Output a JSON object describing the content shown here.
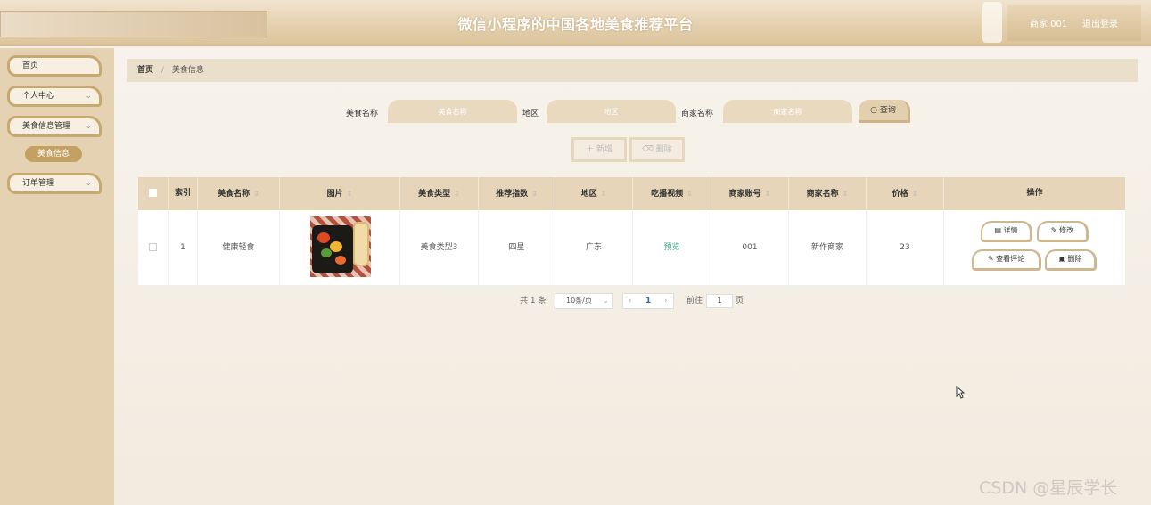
{
  "header": {
    "title": "微信小程序的中国各地美食推荐平台",
    "user": "商家 001",
    "logout": "退出登录"
  },
  "sidebar": {
    "items": [
      {
        "label": "首页"
      },
      {
        "label": "个人中心"
      },
      {
        "label": "美食信息管理"
      },
      {
        "label": "订单管理"
      }
    ],
    "sub_item": "美食信息"
  },
  "breadcrumb": {
    "home": "首页",
    "separator": "/",
    "current": "美食信息"
  },
  "search": {
    "name_label": "美食名称",
    "name_placeholder": "美食名称",
    "region_label": "地区",
    "region_placeholder": "地区",
    "merchant_label": "商家名称",
    "merchant_placeholder": "商家名称",
    "query_button": "查询"
  },
  "actions": {
    "add": "新增",
    "delete": "删除"
  },
  "table": {
    "headers": [
      "索引",
      "美食名称",
      "图片",
      "美食类型",
      "推荐指数",
      "地区",
      "吃播视频",
      "商家账号",
      "商家名称",
      "价格",
      "操作"
    ],
    "rows": [
      {
        "index": "1",
        "name": "健康轻食",
        "type": "美食类型3",
        "rating": "四星",
        "region": "广东",
        "video": "预览",
        "merchant_account": "001",
        "merchant_name": "新作商家",
        "price": "23",
        "ops": {
          "detail": "详情",
          "edit": "修改",
          "comments": "查看评论",
          "delete": "删除"
        }
      }
    ]
  },
  "pagination": {
    "total": "共 1 条",
    "page_size": "10条/页",
    "current_page": "1",
    "goto_label": "前往",
    "goto_value": "1",
    "page_suffix": "页"
  },
  "watermark": "CSDN @星辰学长",
  "colors": {
    "accent": "#c3a165",
    "header_bg": "#e3cfac",
    "sidebar_bg": "#e4d2b3"
  }
}
